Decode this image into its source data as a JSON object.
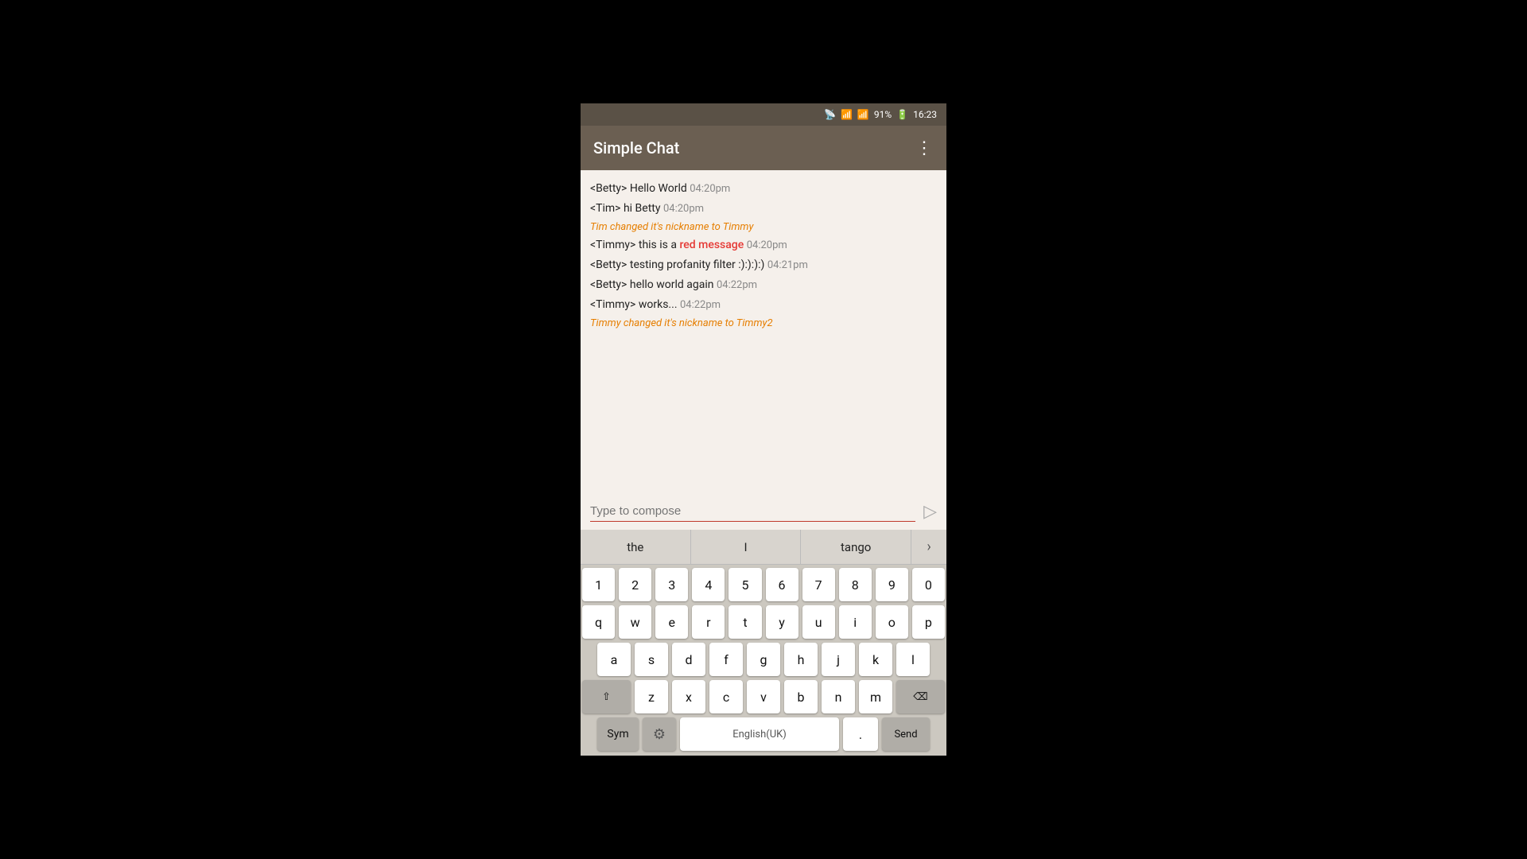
{
  "status_bar": {
    "battery": "91%",
    "time": "16:23",
    "icons": [
      "cast-icon",
      "wifi-icon",
      "signal-icon",
      "battery-icon"
    ]
  },
  "app_bar": {
    "title": "Simple Chat",
    "more_icon": "⋮"
  },
  "chat": {
    "messages": [
      {
        "id": 1,
        "type": "chat",
        "sender": "<Betty>",
        "text": " Hello World ",
        "time": "04:20pm",
        "red": null
      },
      {
        "id": 2,
        "type": "chat",
        "sender": "<Tim>",
        "text": " hi Betty ",
        "time": "04:20pm",
        "red": null
      },
      {
        "id": 3,
        "type": "system",
        "text": "Tim changed it's nickname to Timmy"
      },
      {
        "id": 4,
        "type": "chat",
        "sender": "<Timmy>",
        "text_before": " this is a ",
        "red": "red message",
        "text_after": " ",
        "time": "04:20pm"
      },
      {
        "id": 5,
        "type": "chat",
        "sender": "<Betty>",
        "text": " testing profanity filter :):):):) ",
        "time": "04:21pm",
        "red": null
      },
      {
        "id": 6,
        "type": "chat",
        "sender": "<Betty>",
        "text": " hello world again ",
        "time": "04:22pm",
        "red": null
      },
      {
        "id": 7,
        "type": "chat",
        "sender": "<Timmy>",
        "text": " works... ",
        "time": "04:22pm",
        "red": null
      },
      {
        "id": 8,
        "type": "system",
        "text": "Timmy changed it's nickname to Timmy2"
      }
    ]
  },
  "compose": {
    "placeholder": "Type to compose",
    "send_icon": "▷"
  },
  "autocomplete": {
    "suggestions": [
      "the",
      "I",
      "tango"
    ],
    "arrow": "›"
  },
  "keyboard": {
    "row_numbers": [
      "1",
      "2",
      "3",
      "4",
      "5",
      "6",
      "7",
      "8",
      "9",
      "0"
    ],
    "row_qwerty": [
      "q",
      "w",
      "e",
      "r",
      "t",
      "y",
      "u",
      "i",
      "o",
      "p"
    ],
    "row_asdf": [
      "a",
      "s",
      "d",
      "f",
      "g",
      "h",
      "j",
      "k",
      "l"
    ],
    "row_zxcv": [
      "z",
      "x",
      "c",
      "v",
      "b",
      "n",
      "m"
    ],
    "shift_icon": "⇧",
    "backspace_icon": "⌫",
    "sym": "Sym",
    "gear": "⚙",
    "language": "English(UK)",
    "dot": ".",
    "send": "Send"
  }
}
